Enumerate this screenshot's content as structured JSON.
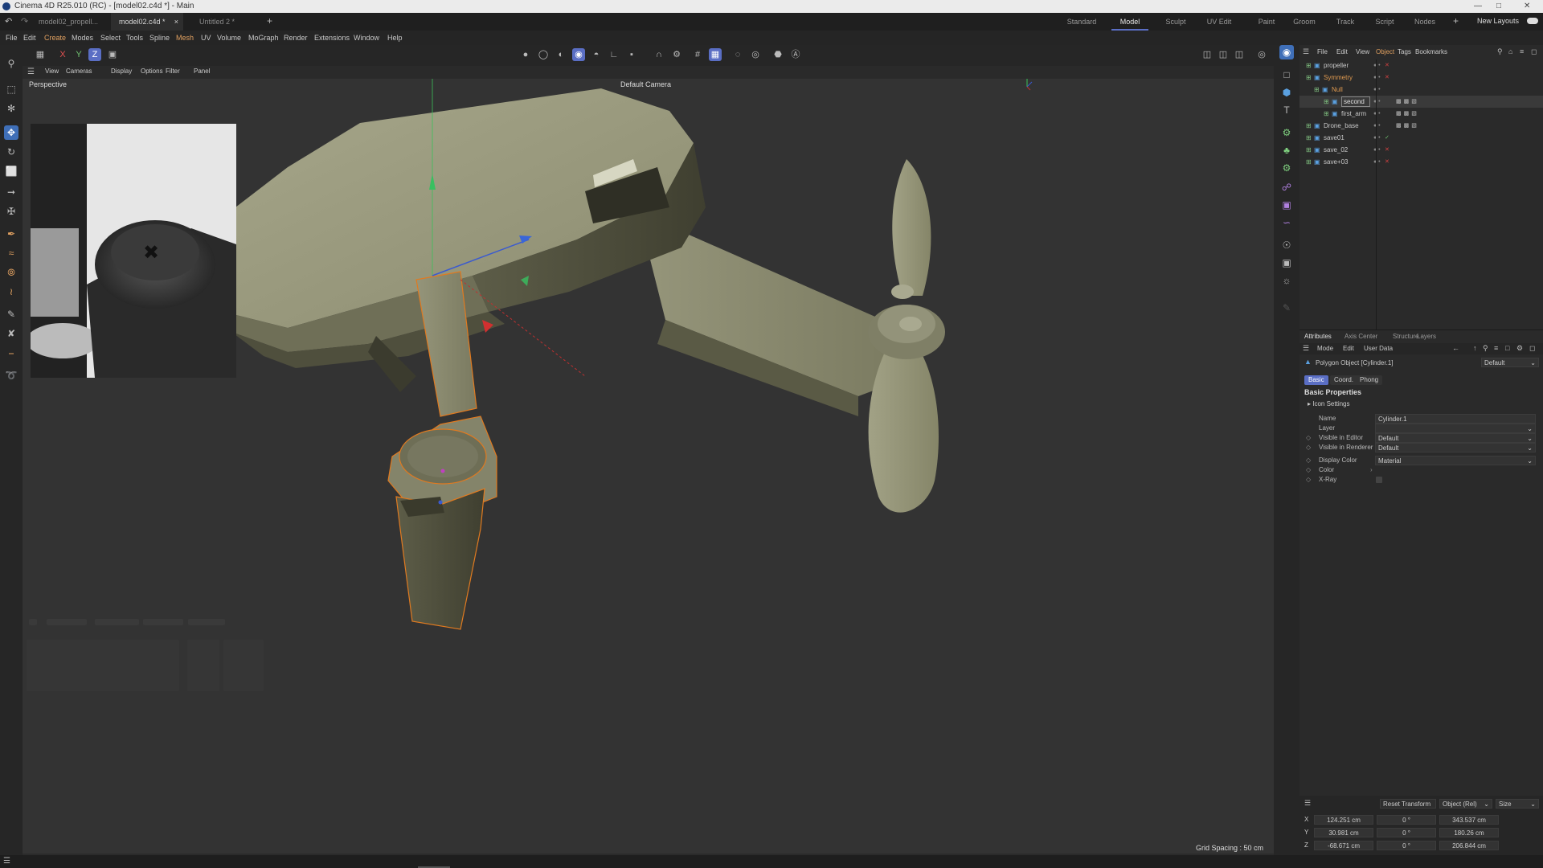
{
  "window": {
    "title": "Cinema 4D R25.010 (RC) - [model02.c4d *] - Main"
  },
  "doc_tabs": [
    {
      "label": "model02_propell...",
      "active": false
    },
    {
      "label": "model02.c4d *",
      "active": true
    },
    {
      "label": "Untitled 2 *",
      "active": false
    }
  ],
  "layouts": [
    "Standard",
    "Model",
    "Sculpt",
    "UV Edit",
    "Paint",
    "Groom",
    "Track",
    "Script",
    "Nodes"
  ],
  "active_layout": "Model",
  "new_layouts_label": "New Layouts",
  "menu": [
    "File",
    "Edit",
    "Create",
    "Modes",
    "Select",
    "Tools",
    "Spline",
    "Mesh",
    "UV",
    "Volume",
    "MoGraph",
    "Render",
    "Extensions",
    "Window",
    "Help"
  ],
  "axis_toggles": [
    "X",
    "Y",
    "Z"
  ],
  "viewport_menu": [
    "View",
    "Cameras",
    "Display",
    "Options",
    "Filter",
    "Panel"
  ],
  "viewport": {
    "projection": "Perspective",
    "camera": "Default Camera",
    "grid_spacing": "Grid Spacing : 50 cm"
  },
  "object_manager": {
    "menu": [
      "File",
      "Edit",
      "View",
      "Object",
      "Tags",
      "Bookmarks"
    ],
    "active_menu": "Object",
    "objects": [
      {
        "name": "propeller",
        "color": "#c8c8c8",
        "selected": false
      },
      {
        "name": "Symmetry",
        "color": "#e09a50",
        "selected": false
      },
      {
        "name": "Null",
        "color": "#e09a50",
        "selected": false
      },
      {
        "name": "second",
        "color": "#e0e0e0",
        "selected": true
      },
      {
        "name": "first_arm",
        "color": "#c8c8c8",
        "selected": false
      },
      {
        "name": "Drone_base",
        "color": "#c8c8c8",
        "selected": false
      },
      {
        "name": "save01",
        "color": "#c8c8c8",
        "selected": false
      },
      {
        "name": "save_02",
        "color": "#c8c8c8",
        "selected": false
      },
      {
        "name": "save+03",
        "color": "#c8c8c8",
        "selected": false
      }
    ]
  },
  "attributes": {
    "tabs": [
      "Attributes",
      "Axis Center",
      "Structure",
      "Layers"
    ],
    "menu": [
      "Mode",
      "Edit",
      "User Data"
    ],
    "object_title": "Polygon Object [Cylinder.1]",
    "preset": "Default",
    "subtabs": [
      "Basic",
      "Coord.",
      "Phong"
    ],
    "section": "Basic Properties",
    "subsection": "Icon Settings",
    "fields": [
      {
        "label": "Name",
        "value": "Cylinder.1"
      },
      {
        "label": "Layer",
        "value": ""
      },
      {
        "label": "Visible in Editor",
        "value": "Default"
      },
      {
        "label": "Visible in Renderer",
        "value": "Default"
      },
      {
        "label": "Display Color",
        "value": "Material"
      },
      {
        "label": "Color",
        "value": ""
      },
      {
        "label": "X-Ray",
        "value": ""
      }
    ]
  },
  "coords": {
    "reset_label": "Reset Transform",
    "mode": "Object (Rel)",
    "size_mode": "Size",
    "rows": [
      {
        "axis": "X",
        "pos": "124.251 cm",
        "rot": "0 °",
        "size": "343.537 cm"
      },
      {
        "axis": "Y",
        "pos": "30.981 cm",
        "rot": "0 °",
        "size": "180.26 cm"
      },
      {
        "axis": "Z",
        "pos": "-68.671 cm",
        "rot": "0 °",
        "size": "206.844 cm"
      }
    ]
  },
  "colors": {
    "accent": "#5a6ec4",
    "model": "#8f8f6f",
    "selection": "#e07a20"
  }
}
